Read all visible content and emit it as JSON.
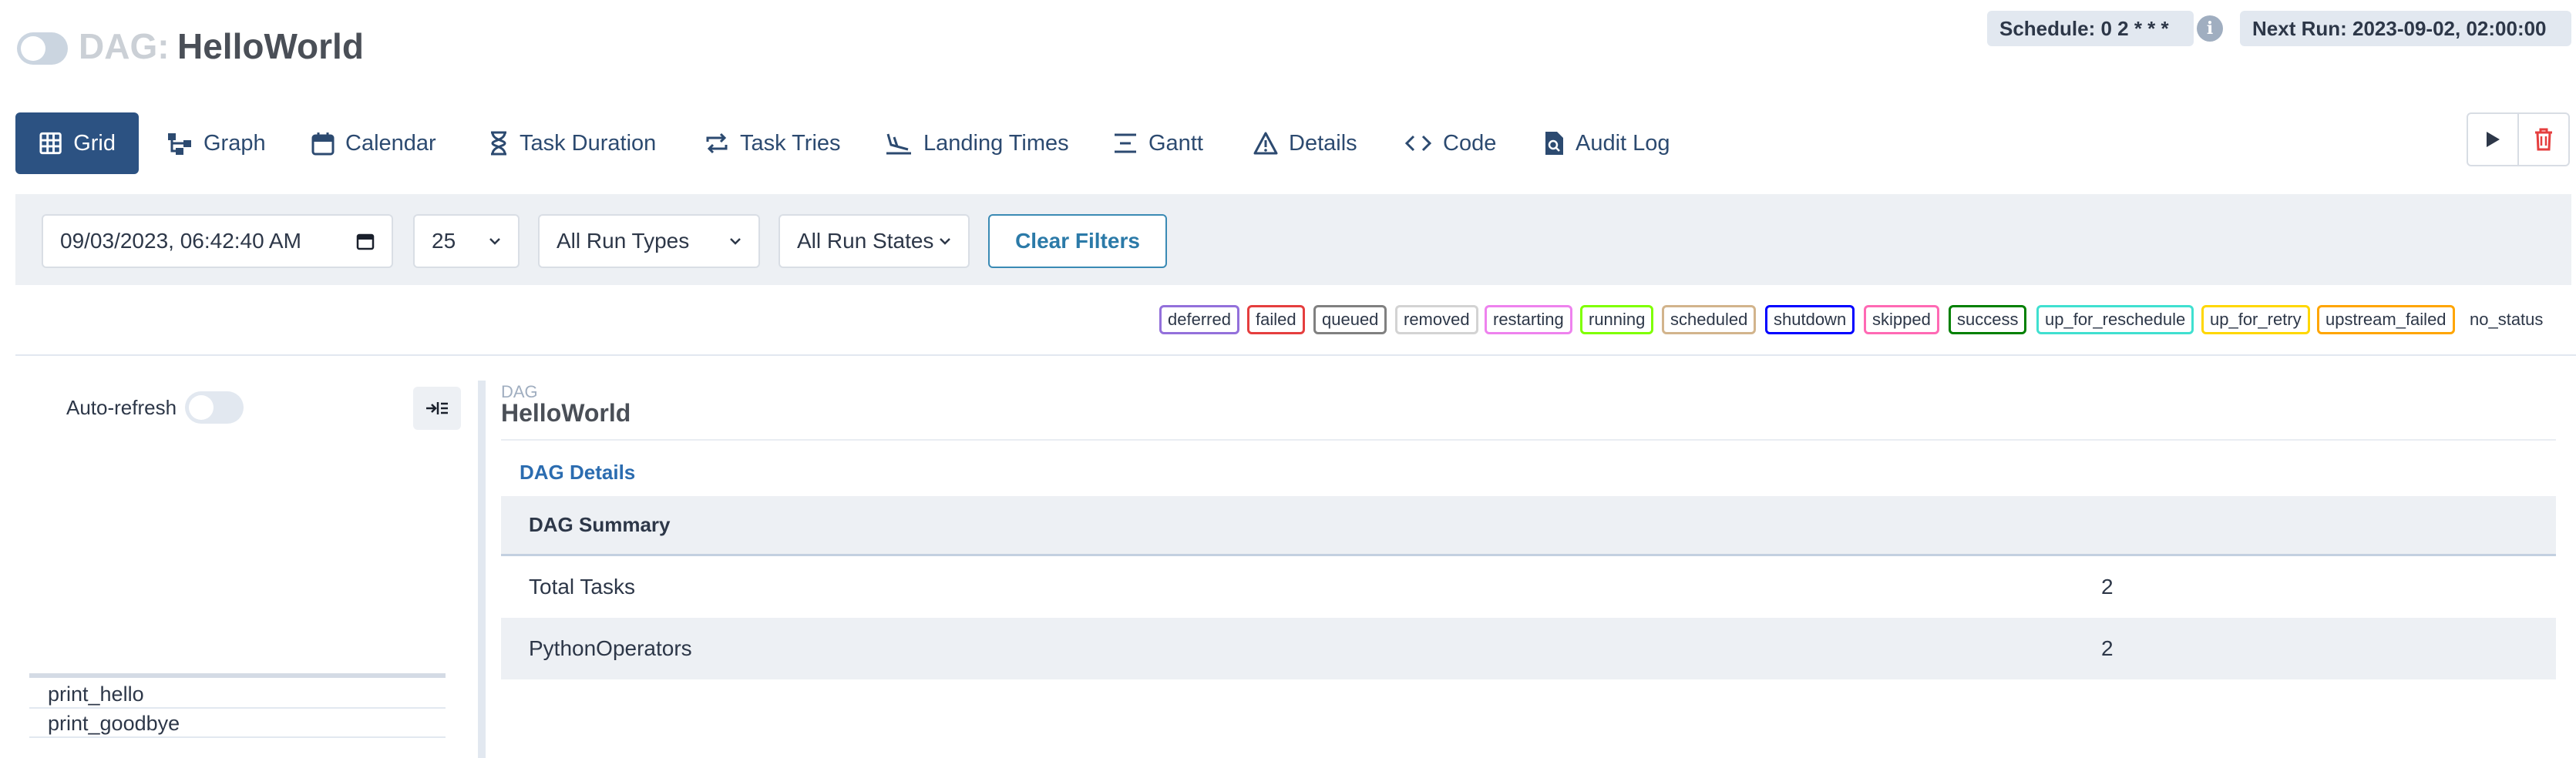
{
  "header": {
    "dag_prefix": "DAG:",
    "dag_name": "HelloWorld",
    "schedule": "Schedule: 0 2 * * *",
    "next_run": "Next Run: 2023-09-02, 02:00:00",
    "info_glyph": "i"
  },
  "tabs": [
    {
      "label": "Grid",
      "icon": "grid-icon",
      "active": true
    },
    {
      "label": "Graph",
      "icon": "graph-icon"
    },
    {
      "label": "Calendar",
      "icon": "calendar-icon"
    },
    {
      "label": "Task Duration",
      "icon": "hourglass-icon"
    },
    {
      "label": "Task Tries",
      "icon": "repeat-icon"
    },
    {
      "label": "Landing Times",
      "icon": "plane-landing-icon"
    },
    {
      "label": "Gantt",
      "icon": "gantt-icon"
    },
    {
      "label": "Details",
      "icon": "warning-triangle-icon"
    },
    {
      "label": "Code",
      "icon": "code-icon"
    },
    {
      "label": "Audit Log",
      "icon": "file-search-icon"
    }
  ],
  "actions": {
    "trigger": "play-icon",
    "delete": "trash-icon",
    "delete_color": "#e53e3e"
  },
  "filters": {
    "date": "09/03/2023, 06:42:40  AM",
    "num_runs": "25",
    "run_types": "All Run Types",
    "run_states": "All Run States",
    "clear": "Clear Filters"
  },
  "states": [
    {
      "name": "deferred",
      "color": "#9370db"
    },
    {
      "name": "failed",
      "color": "#e53e3e"
    },
    {
      "name": "queued",
      "color": "#808080"
    },
    {
      "name": "removed",
      "color": "#d3d3d3"
    },
    {
      "name": "restarting",
      "color": "#ee82ee"
    },
    {
      "name": "running",
      "color": "#7fff00"
    },
    {
      "name": "scheduled",
      "color": "#d2b48c"
    },
    {
      "name": "shutdown",
      "color": "#0000ff"
    },
    {
      "name": "skipped",
      "color": "#ff69b4"
    },
    {
      "name": "success",
      "color": "#008000"
    },
    {
      "name": "up_for_reschedule",
      "color": "#40e0d0"
    },
    {
      "name": "up_for_retry",
      "color": "#ffd700"
    },
    {
      "name": "upstream_failed",
      "color": "#ffa500"
    }
  ],
  "no_status": "no_status",
  "left_panel": {
    "auto_refresh": "Auto-refresh",
    "tasks": [
      "print_hello",
      "print_goodbye"
    ]
  },
  "details": {
    "label": "DAG",
    "title": "HelloWorld",
    "link": "DAG Details",
    "summary_header": "DAG Summary",
    "rows": [
      {
        "label": "Total Tasks",
        "value": "2"
      },
      {
        "label": "PythonOperators",
        "value": "2"
      }
    ]
  }
}
